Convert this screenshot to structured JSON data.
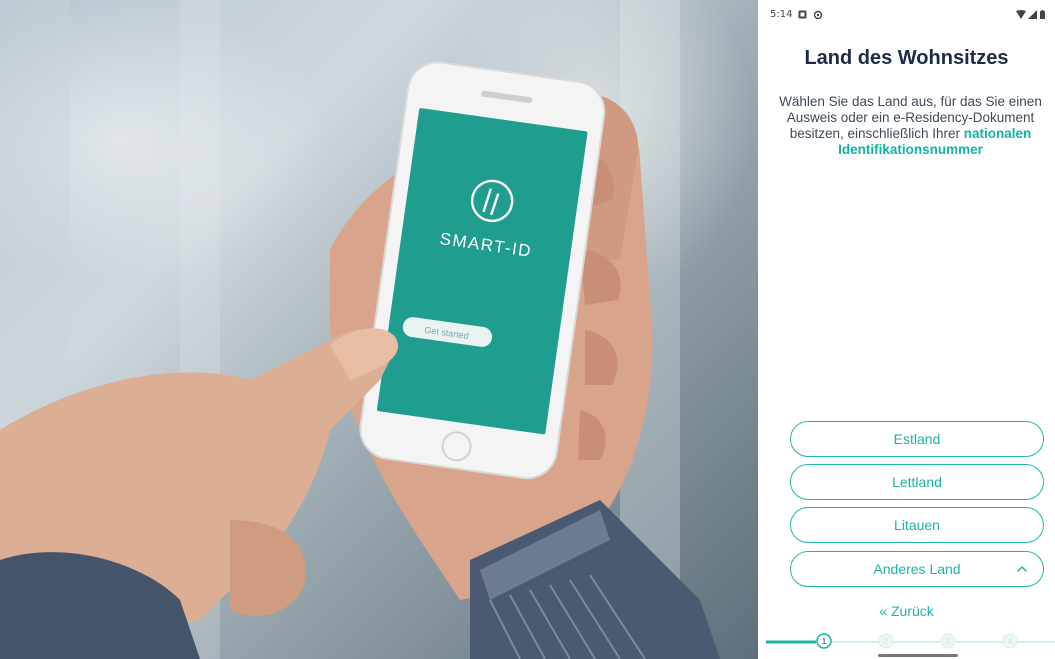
{
  "hero": {
    "app_logo_text": "SMART-ID",
    "phone_button_label": "Get started"
  },
  "status_bar": {
    "time": "5:14"
  },
  "page": {
    "title": "Land des Wohnsitzes",
    "description_prefix": "Wählen Sie das Land aus, für das Sie einen Ausweis oder ein e-Residency-Dokument besitzen, einschließlich Ihrer ",
    "description_highlight": "nationalen Identifikationsnummer"
  },
  "countries": [
    {
      "label": "Estland"
    },
    {
      "label": "Lettland"
    },
    {
      "label": "Litauen"
    }
  ],
  "other_country": {
    "label": "Anderes Land",
    "icon": "chevron-up-icon"
  },
  "back": {
    "label": "« Zurück"
  },
  "stepper": {
    "steps": [
      "1",
      "2",
      "3",
      "4"
    ],
    "current_step": 1
  },
  "colors": {
    "accent": "#1fb3a2",
    "title": "#1c2b48",
    "phone_screen": "#1f9e8f"
  }
}
